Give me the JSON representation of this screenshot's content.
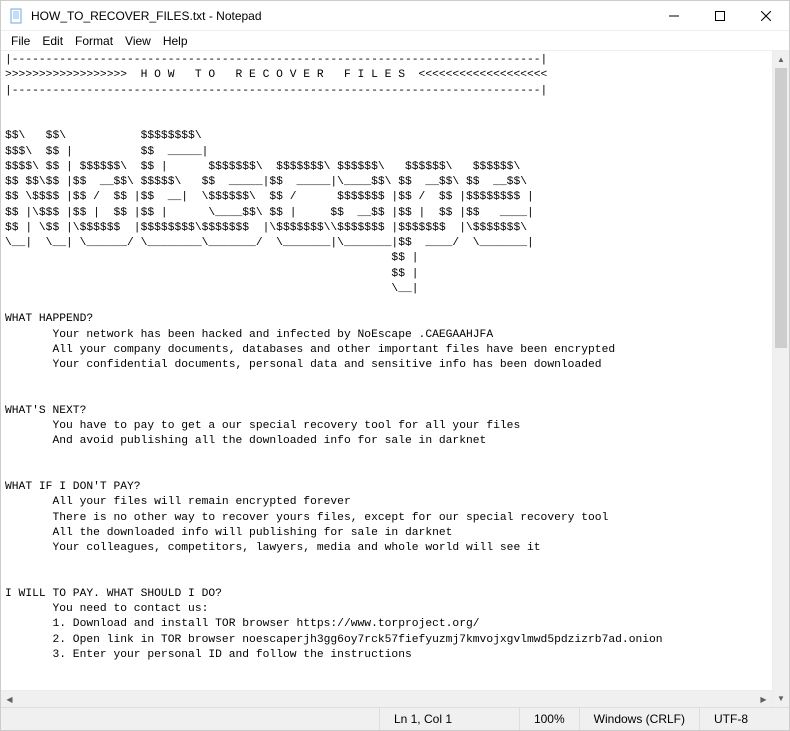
{
  "titlebar": {
    "title": "HOW_TO_RECOVER_FILES.txt - Notepad"
  },
  "menubar": {
    "file": "File",
    "edit": "Edit",
    "format": "Format",
    "view": "View",
    "help": "Help"
  },
  "body_text": "|------------------------------------------------------------------------------|\n>>>>>>>>>>>>>>>>>>  H O W   T O   R E C O V E R   F I L E S  <<<<<<<<<<<<<<<<<<<\n|------------------------------------------------------------------------------|\n\n\n$$\\   $$\\           $$$$$$$$\\\n$$$\\  $$ |          $$  _____|\n$$$$\\ $$ | $$$$$$\\  $$ |      $$$$$$$\\  $$$$$$$\\ $$$$$$\\   $$$$$$\\   $$$$$$\\\n$$ $$\\$$ |$$  __$$\\ $$$$$\\   $$  _____|$$  _____|\\____$$\\ $$  __$$\\ $$  __$$\\\n$$ \\$$$$ |$$ /  $$ |$$  __|  \\$$$$$$\\  $$ /      $$$$$$$ |$$ /  $$ |$$$$$$$$ |\n$$ |\\$$$ |$$ |  $$ |$$ |      \\____$$\\ $$ |     $$  __$$ |$$ |  $$ |$$   ____|\n$$ | \\$$ |\\$$$$$$  |$$$$$$$$\\$$$$$$$  |\\$$$$$$$\\\\$$$$$$$ |$$$$$$$  |\\$$$$$$$\\\n\\__|  \\__| \\______/ \\________\\_______/  \\_______|\\_______|$$  ____/  \\_______|\n                                                         $$ |\n                                                         $$ |\n                                                         \\__|\n\nWHAT HAPPEND?\n       Your network has been hacked and infected by NoEscape .CAEGAAHJFA\n       All your company documents, databases and other important files have been encrypted\n       Your confidential documents, personal data and sensitive info has been downloaded\n\n\nWHAT'S NEXT?\n       You have to pay to get a our special recovery tool for all your files\n       And avoid publishing all the downloaded info for sale in darknet\n\n\nWHAT IF I DON'T PAY?\n       All your files will remain encrypted forever\n       There is no other way to recover yours files, except for our special recovery tool\n       All the downloaded info will publishing for sale in darknet\n       Your colleagues, competitors, lawyers, media and whole world will see it\n\n\nI WILL TO PAY. WHAT SHOULD I DO?\n       You need to contact us:\n       1. Download and install TOR browser https://www.torproject.org/\n       2. Open link in TOR browser noescaperjh3gg6oy7rck57fiefyuzmj7kmvojxgvlmwd5pdzizrb7ad.onion\n       3. Enter your personal ID and follow the instructions",
  "statusbar": {
    "position": "Ln 1, Col 1",
    "zoom": "100%",
    "line_ending": "Windows (CRLF)",
    "encoding": "UTF-8"
  }
}
